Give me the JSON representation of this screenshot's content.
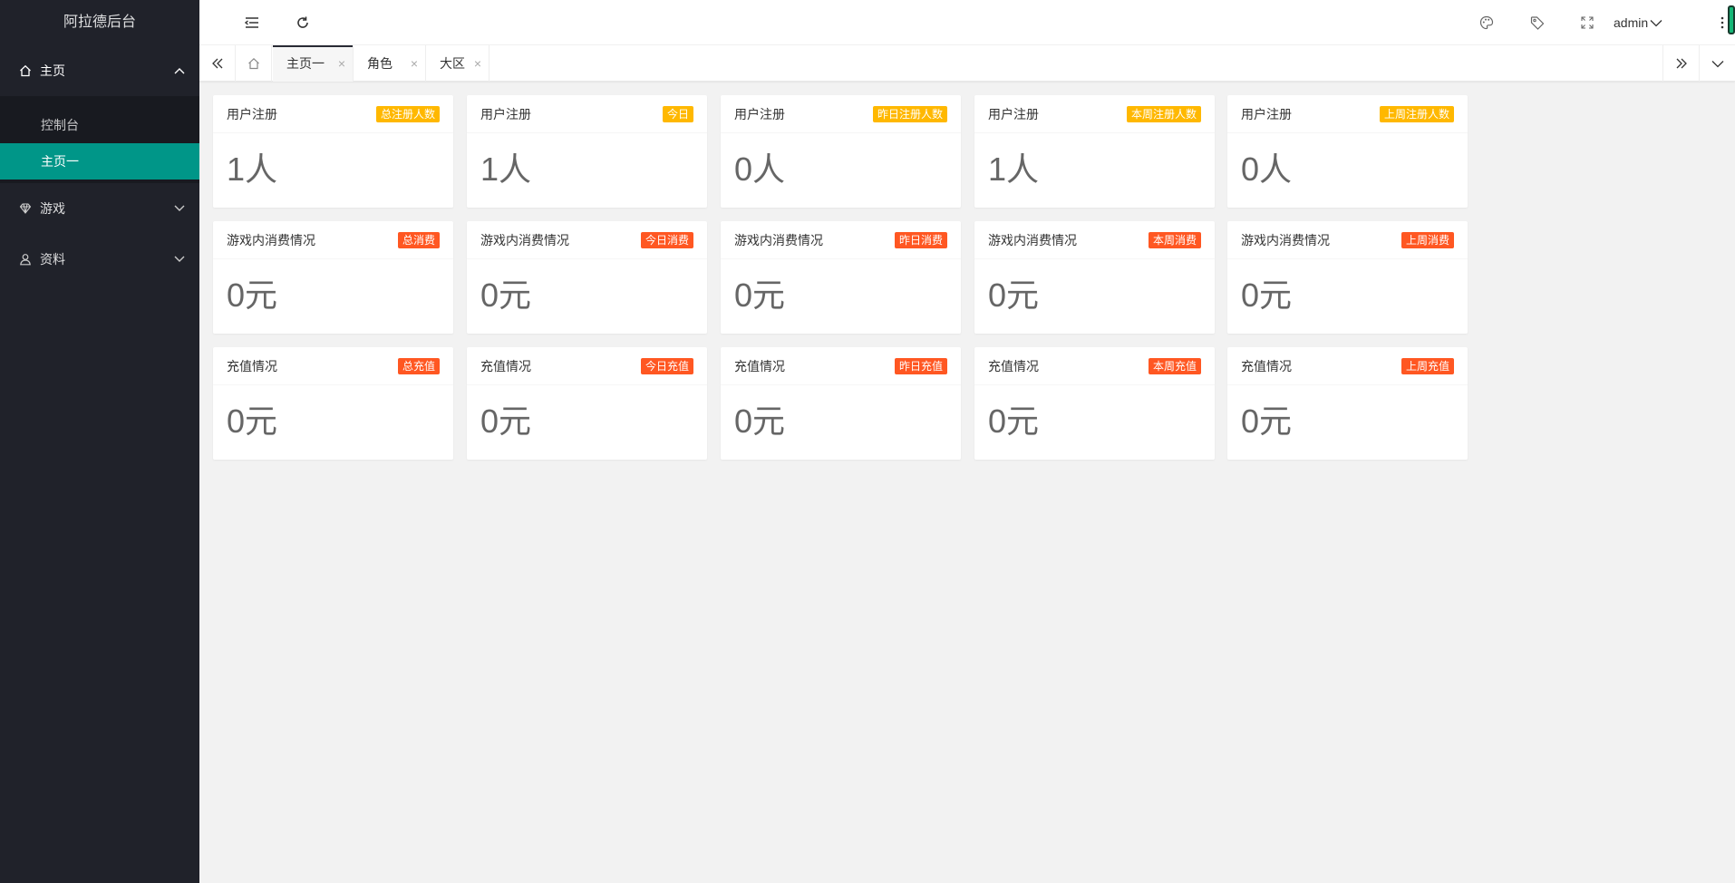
{
  "app": {
    "title": "阿拉德后台"
  },
  "sidebar": {
    "items": [
      {
        "label": "主页",
        "icon": "home-icon"
      },
      {
        "label": "游戏",
        "icon": "diamond-icon"
      },
      {
        "label": "资料",
        "icon": "user-icon"
      }
    ],
    "submenu": [
      {
        "label": "控制台"
      },
      {
        "label": "主页一"
      }
    ]
  },
  "header": {
    "user": "admin"
  },
  "tabs": [
    {
      "label": "主页一",
      "close": "×"
    },
    {
      "label": "角色",
      "close": "×"
    },
    {
      "label": "大区",
      "close": "×"
    }
  ],
  "colors": {
    "sidebar": "#20222a",
    "active": "#009688",
    "badge_yellow": "#ffb800",
    "badge_red": "#ff5722"
  },
  "cards": [
    [
      {
        "title": "用户注册",
        "badge": "总注册人数",
        "value": "1人"
      },
      {
        "title": "用户注册",
        "badge": "今日",
        "value": "1人"
      },
      {
        "title": "用户注册",
        "badge": "昨日注册人数",
        "value": "0人"
      },
      {
        "title": "用户注册",
        "badge": "本周注册人数",
        "value": "1人"
      },
      {
        "title": "用户注册",
        "badge": "上周注册人数",
        "value": "0人"
      }
    ],
    [
      {
        "title": "游戏内消费情况",
        "badge": "总消费",
        "value": "0元"
      },
      {
        "title": "游戏内消费情况",
        "badge": "今日消费",
        "value": "0元"
      },
      {
        "title": "游戏内消费情况",
        "badge": "昨日消费",
        "value": "0元"
      },
      {
        "title": "游戏内消费情况",
        "badge": "本周消费",
        "value": "0元"
      },
      {
        "title": "游戏内消费情况",
        "badge": "上周消费",
        "value": "0元"
      }
    ],
    [
      {
        "title": "充值情况",
        "badge": "总充值",
        "value": "0元"
      },
      {
        "title": "充值情况",
        "badge": "今日充值",
        "value": "0元"
      },
      {
        "title": "充值情况",
        "badge": "昨日充值",
        "value": "0元"
      },
      {
        "title": "充值情况",
        "badge": "本周充值",
        "value": "0元"
      },
      {
        "title": "充值情况",
        "badge": "上周充值",
        "value": "0元"
      }
    ]
  ]
}
